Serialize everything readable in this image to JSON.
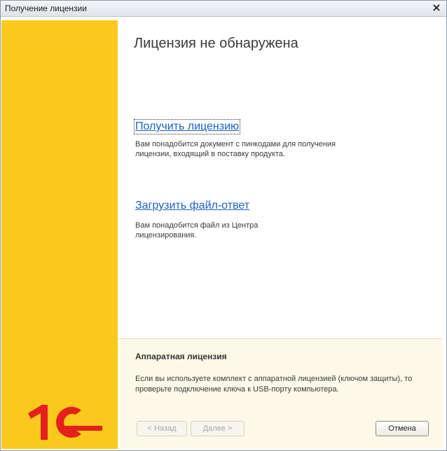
{
  "window": {
    "title": "Получение лицензии"
  },
  "main": {
    "heading": "Лицензия не обнаружена",
    "options": [
      {
        "link": "Получить лицензию",
        "description": "Вам понадобится документ с пинкодами для получения лицензии, входящий в поставку продукта."
      },
      {
        "link": "Загрузить файл-ответ",
        "description": "Вам понадобится файл из Центра лицензирования."
      }
    ]
  },
  "info": {
    "title": "Аппаратная лицензия",
    "text": "Если вы используете комплект с аппаратной лицензией (ключом защиты), то проверьте подключение ключа к USB-порту компьютера."
  },
  "buttons": {
    "back": "< Назад",
    "next": "Далее >",
    "cancel": "Отмена"
  },
  "icons": {
    "close": "close-icon",
    "logo": "1c-logo"
  },
  "colors": {
    "sidebar": "#fbc81c",
    "logo": "#e3201b",
    "link": "#1c5fc9"
  }
}
